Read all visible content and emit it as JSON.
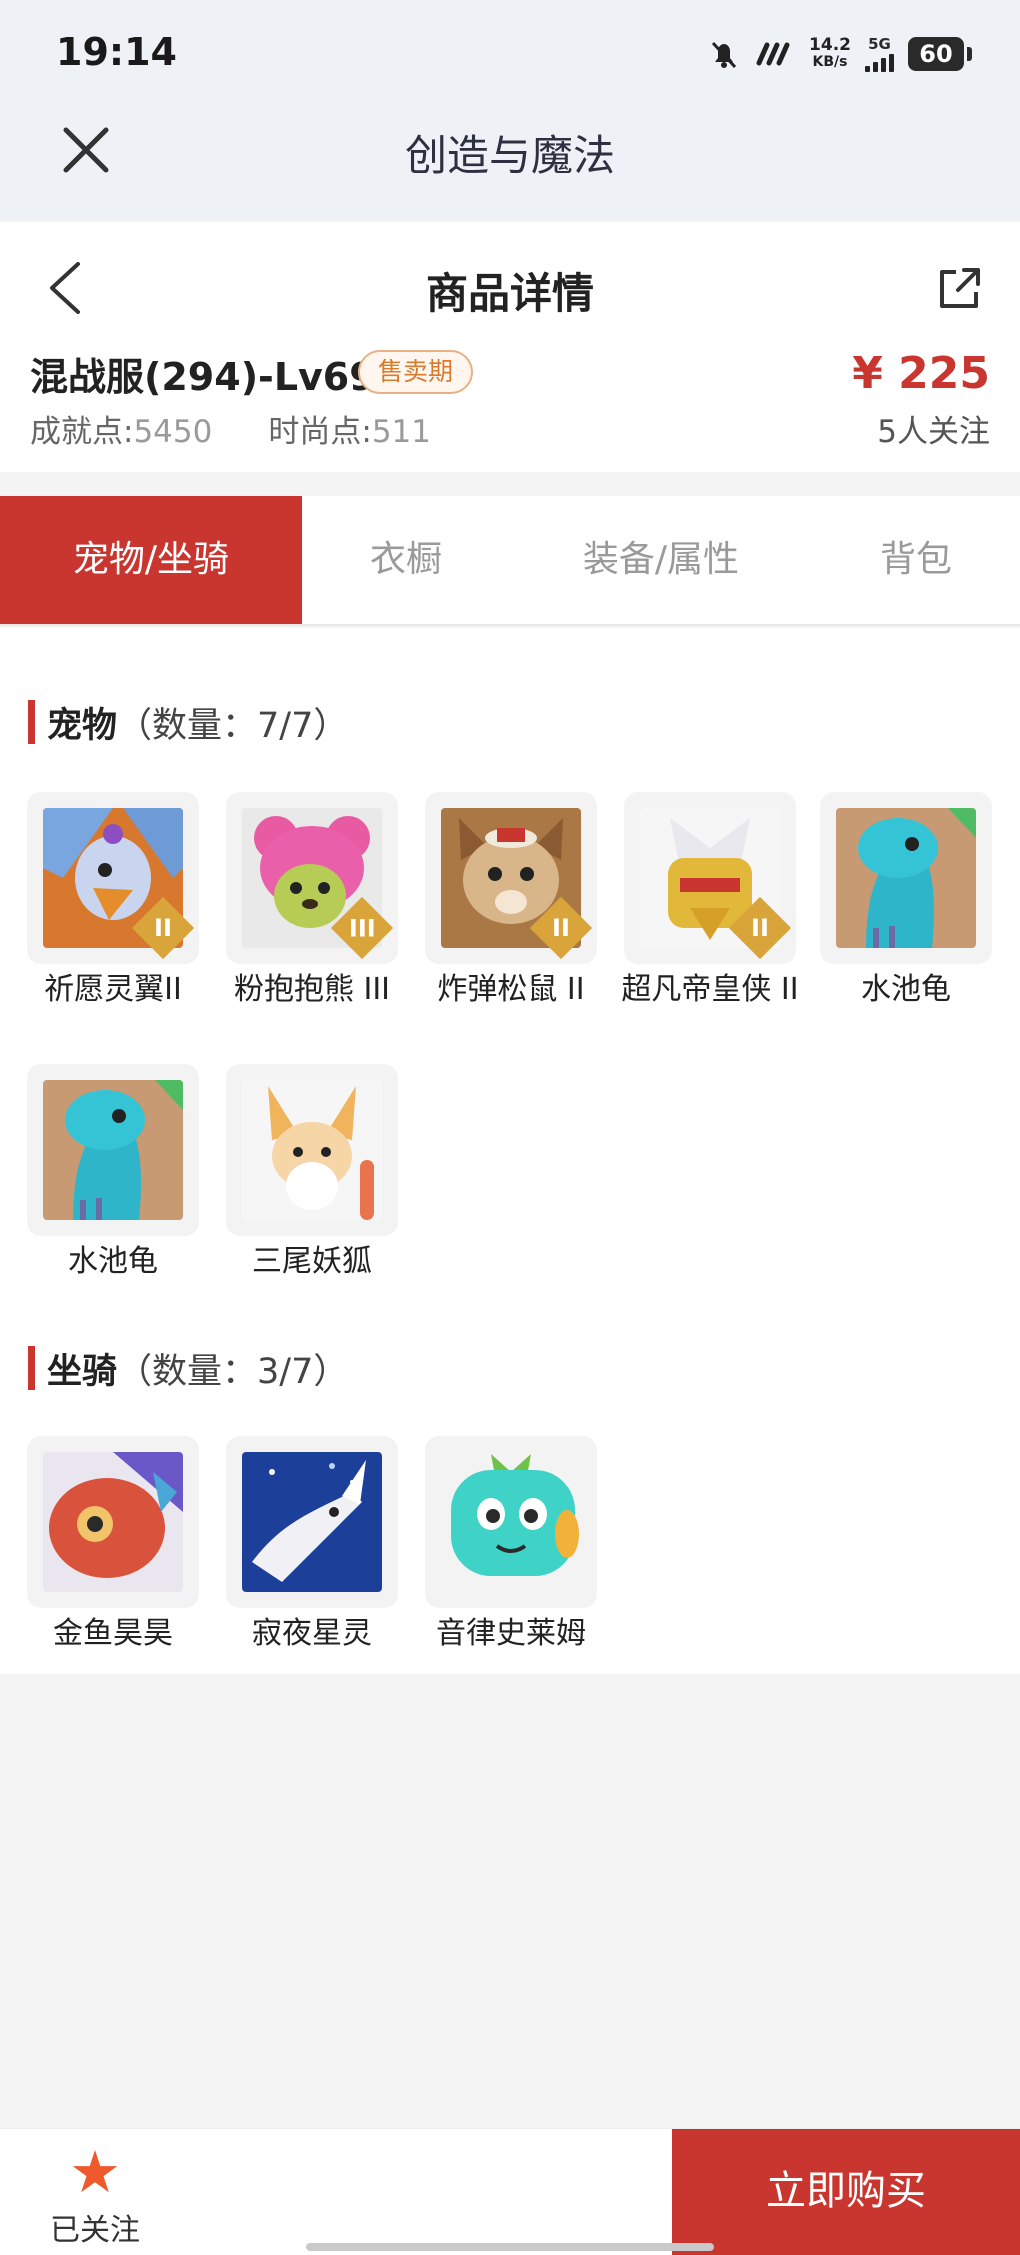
{
  "status_bar": {
    "time": "19:14",
    "net_speed_value": "14.2",
    "net_speed_unit": "KB/s",
    "network_type": "5G",
    "battery": "60"
  },
  "app": {
    "title": "创造与魔法"
  },
  "detail": {
    "title": "商品详情",
    "product_name": "混战服(294)-Lv69",
    "sale_status": "售卖期",
    "price": "¥ 225",
    "achievement_label": "成就点:",
    "achievement_value": "5450",
    "fashion_label": "时尚点:",
    "fashion_value": "511",
    "followers": "5人关注"
  },
  "tabs": [
    {
      "label": "宠物/坐骑",
      "active": true
    },
    {
      "label": "衣橱",
      "active": false
    },
    {
      "label": "装备/属性",
      "active": false
    },
    {
      "label": "背包",
      "active": false
    }
  ],
  "pets": {
    "title": "宠物",
    "count": "（数量：7/7）",
    "items": [
      {
        "name": "祈愿灵翼II",
        "tier": "II",
        "icon": "winged-bird-pet"
      },
      {
        "name": "粉抱抱熊 III",
        "tier": "III",
        "icon": "pink-bear-pet"
      },
      {
        "name": "炸弹松鼠 II",
        "tier": "II",
        "icon": "squirrel-pet"
      },
      {
        "name": "超凡帝皇侠 II",
        "tier": "II",
        "icon": "golden-knight-pet"
      },
      {
        "name": "水池龟",
        "tier": "",
        "icon": "turtle-pet"
      },
      {
        "name": "水池龟",
        "tier": "",
        "icon": "turtle-pet"
      },
      {
        "name": "三尾妖狐",
        "tier": "",
        "icon": "fox-pet"
      }
    ]
  },
  "mounts": {
    "title": "坐骑",
    "count": "（数量：3/7）",
    "items": [
      {
        "name": "金鱼昊昊",
        "icon": "goldfish-mount"
      },
      {
        "name": "寂夜星灵",
        "icon": "night-star-mount"
      },
      {
        "name": "音律史莱姆",
        "icon": "slime-mount"
      }
    ]
  },
  "bottom": {
    "follow_label": "已关注",
    "buy_label": "立即购买"
  },
  "colors": {
    "accent": "#c8362f",
    "badge_text": "#d97b2c",
    "follow_star": "#ee5a2c",
    "tier_badge": "#d9a53a"
  }
}
